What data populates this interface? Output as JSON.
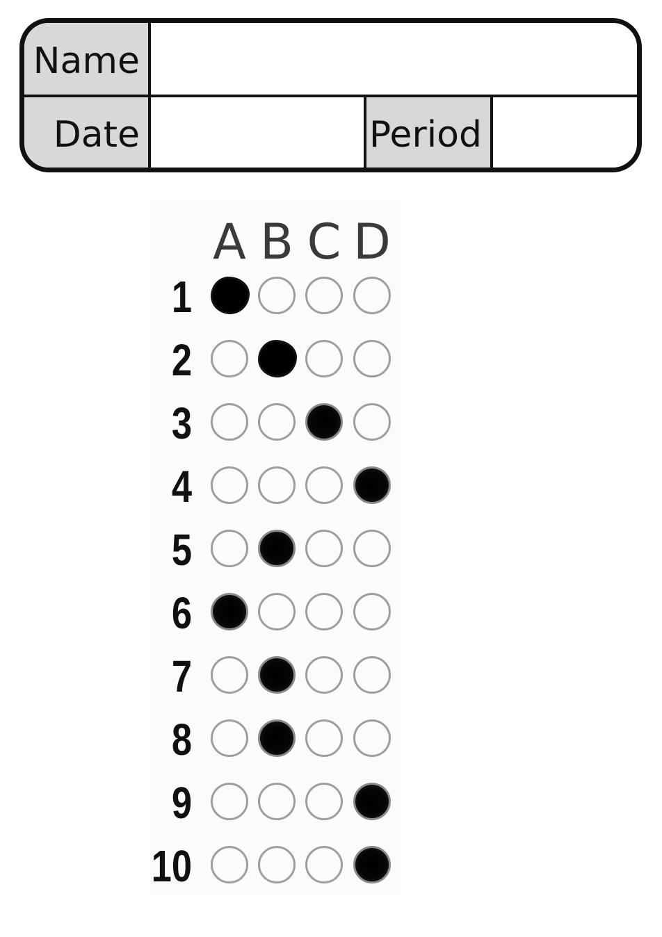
{
  "header": {
    "name_label": "Name",
    "name_value": "",
    "date_label": "Date",
    "date_value": "",
    "period_label": "Period",
    "period_value": ""
  },
  "answer_sheet": {
    "choices": [
      "A",
      "B",
      "C",
      "D"
    ],
    "questions": [
      {
        "number": "1",
        "selected": "A"
      },
      {
        "number": "2",
        "selected": "B"
      },
      {
        "number": "3",
        "selected": "C"
      },
      {
        "number": "4",
        "selected": "D"
      },
      {
        "number": "5",
        "selected": "B"
      },
      {
        "number": "6",
        "selected": "A"
      },
      {
        "number": "7",
        "selected": "B"
      },
      {
        "number": "8",
        "selected": "B"
      },
      {
        "number": "9",
        "selected": "D"
      },
      {
        "number": "10",
        "selected": "D"
      }
    ]
  },
  "colors": {
    "border": "#111111",
    "label_fill": "#d8d8d8",
    "bubble_outline": "#9e9e9e",
    "bubble_fill": "#000000"
  }
}
